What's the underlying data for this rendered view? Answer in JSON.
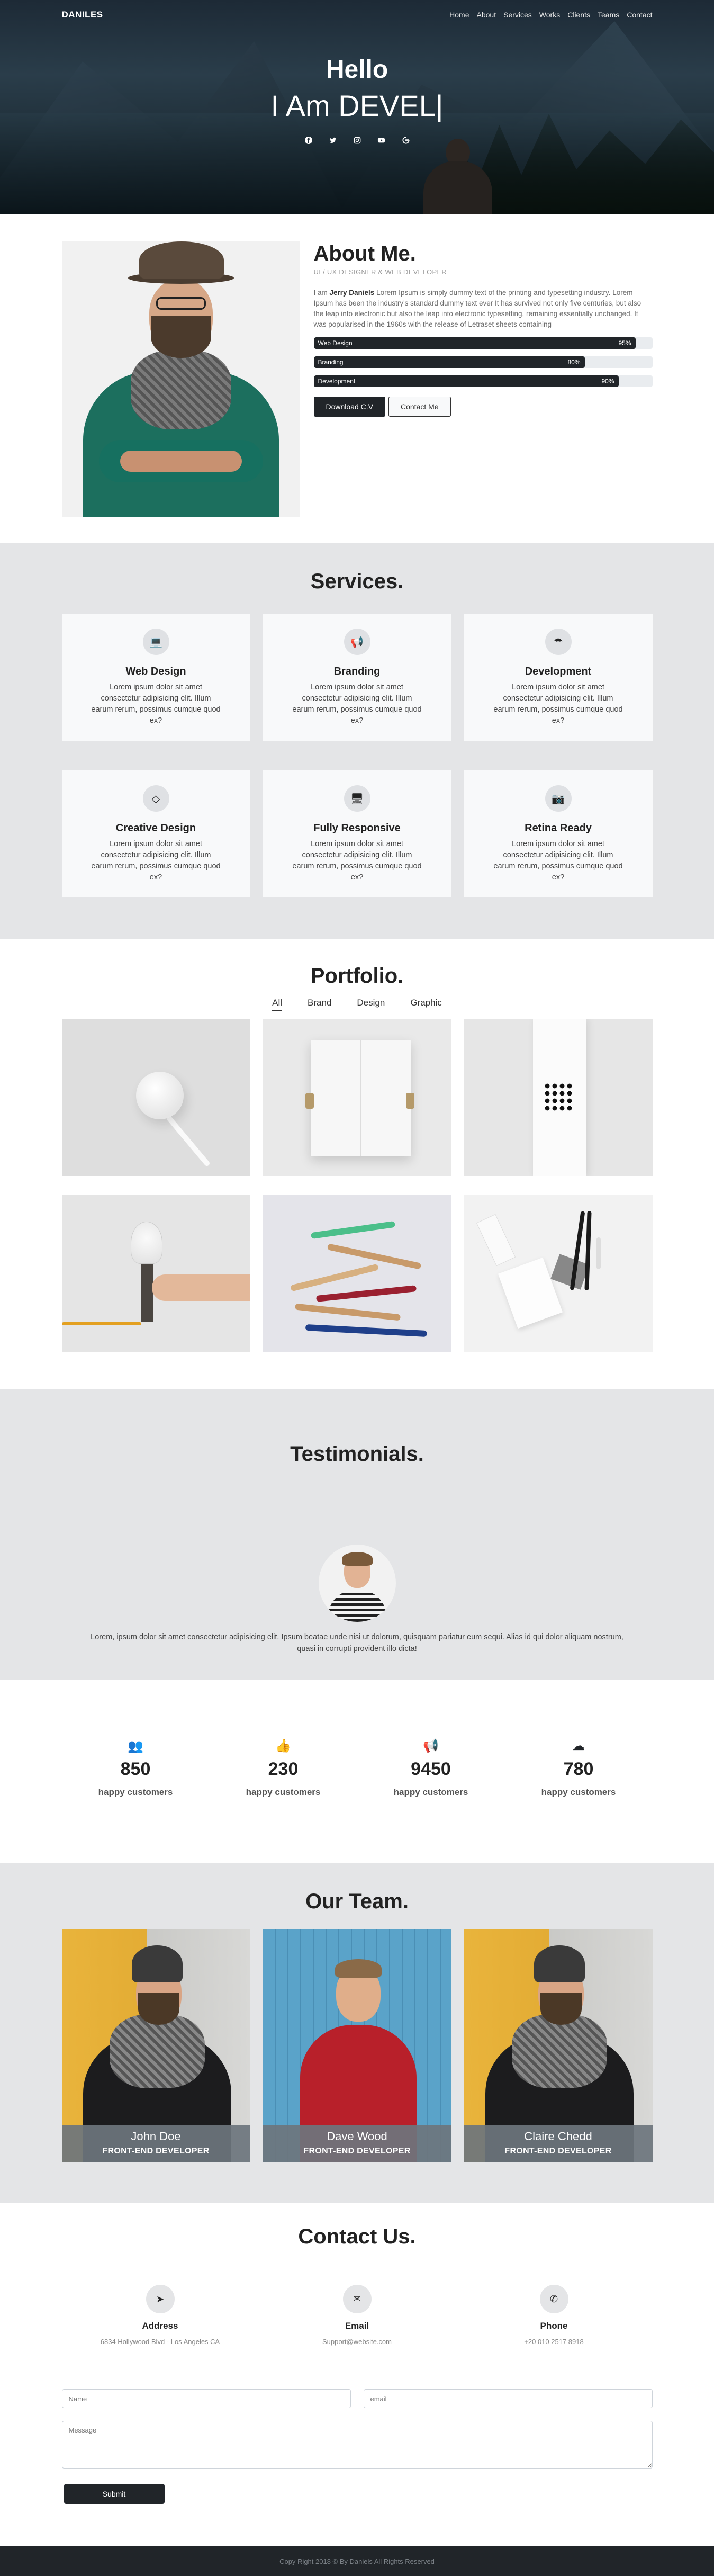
{
  "nav": {
    "brand": "DANILES",
    "items": [
      "Home",
      "About",
      "Services",
      "Works",
      "Clients",
      "Teams",
      "Contact"
    ]
  },
  "hero": {
    "greeting": "Hello",
    "tagline": "I Am DEVEL|",
    "socials": [
      "facebook-icon",
      "twitter-icon",
      "instagram-icon",
      "youtube-icon",
      "google-icon"
    ]
  },
  "about": {
    "title": "About Me.",
    "role": "UI / UX DESIGNER & WEB DEVELOPER",
    "intro": "I am ",
    "name": "Jerry Daniels",
    "bio": " Lorem Ipsum is simply dummy text of the printing and typesetting industry. Lorem Ipsum has been the industry's standard dummy text ever It has survived not only five centuries, but also the leap into electronic but also the leap into electronic typesetting, remaining essentially unchanged. It was popularised in the 1960s with the release of Letraset sheets containing",
    "skills": [
      {
        "label": "Web Design",
        "percent": "95%",
        "value": 95
      },
      {
        "label": "Branding",
        "percent": "80%",
        "value": 80
      },
      {
        "label": "Development",
        "percent": "90%",
        "value": 90
      }
    ],
    "download_label": "Download C.V",
    "contact_label": "Contact Me"
  },
  "services": {
    "title": "Services.",
    "items": [
      {
        "icon": "laptop-icon",
        "glyph": "💻",
        "title": "Web Design",
        "text": "Lorem ipsum dolor sit amet consectetur adipisicing elit. Illum earum rerum, possimus cumque quod ex?"
      },
      {
        "icon": "bullhorn-icon",
        "glyph": "📢",
        "title": "Branding",
        "text": "Lorem ipsum dolor sit amet consectetur adipisicing elit. Illum earum rerum, possimus cumque quod ex?"
      },
      {
        "icon": "umbrella-icon",
        "glyph": "☂",
        "title": "Development",
        "text": "Lorem ipsum dolor sit amet consectetur adipisicing elit. Illum earum rerum, possimus cumque quod ex?"
      },
      {
        "icon": "gem-icon",
        "glyph": "◇",
        "title": "Creative Design",
        "text": "Lorem ipsum dolor sit amet consectetur adipisicing elit. Illum earum rerum, possimus cumque quod ex?"
      },
      {
        "icon": "desktop-icon",
        "glyph": "🖥",
        "title": "Fully Responsive",
        "text": "Lorem ipsum dolor sit amet consectetur adipisicing elit. Illum earum rerum, possimus cumque quod ex?"
      },
      {
        "icon": "camera-icon",
        "glyph": "📷",
        "title": "Retina Ready",
        "text": "Lorem ipsum dolor sit amet consectetur adipisicing elit. Illum earum rerum, possimus cumque quod ex?"
      }
    ]
  },
  "portfolio": {
    "title": "Portfolio.",
    "tabs": [
      "All",
      "Brand",
      "Design",
      "Graphic"
    ]
  },
  "testimonials": {
    "title": "Testimonials.",
    "quote": "Lorem, ipsum dolor sit amet consectetur adipisicing elit. Ipsum beatae unde nisi ut dolorum, quisquam pariatur eum sequi. Alias id qui dolor aliquam nostrum, quasi in corrupti provident illo dicta!"
  },
  "counters": [
    {
      "icon": "users-icon",
      "glyph": "👥",
      "number": "850",
      "label": "happy customers"
    },
    {
      "icon": "thumbs-up-icon",
      "glyph": "👍",
      "number": "230",
      "label": "happy customers"
    },
    {
      "icon": "bullhorn-icon",
      "glyph": "📢",
      "number": "9450",
      "label": "happy customers"
    },
    {
      "icon": "cloud-download-icon",
      "glyph": "☁",
      "number": "780",
      "label": "happy customers"
    }
  ],
  "team": {
    "title": "Our Team.",
    "members": [
      {
        "name": "John Doe",
        "role": "FRONT-END DEVELOPER"
      },
      {
        "name": "Dave Wood",
        "role": "FRONT-END DEVELOPER"
      },
      {
        "name": "Claire Chedd",
        "role": "FRONT-END DEVELOPER"
      }
    ]
  },
  "contact": {
    "title": "Contact Us.",
    "items": [
      {
        "icon": "location-arrow-icon",
        "glyph": "➤",
        "label": "Address",
        "value": "6834 Hollywood Blvd - Los Angeles CA"
      },
      {
        "icon": "envelope-icon",
        "glyph": "✉",
        "label": "Email",
        "value": "Support@website.com"
      },
      {
        "icon": "phone-icon",
        "glyph": "✆",
        "label": "Phone",
        "value": "+20 010 2517 8918"
      }
    ],
    "name_placeholder": "Name",
    "email_placeholder": "email",
    "message_placeholder": "Message",
    "submit_label": "Submit"
  },
  "footer": {
    "text": "Copy Right 2018 © By Daniels All Rights Reserved"
  }
}
